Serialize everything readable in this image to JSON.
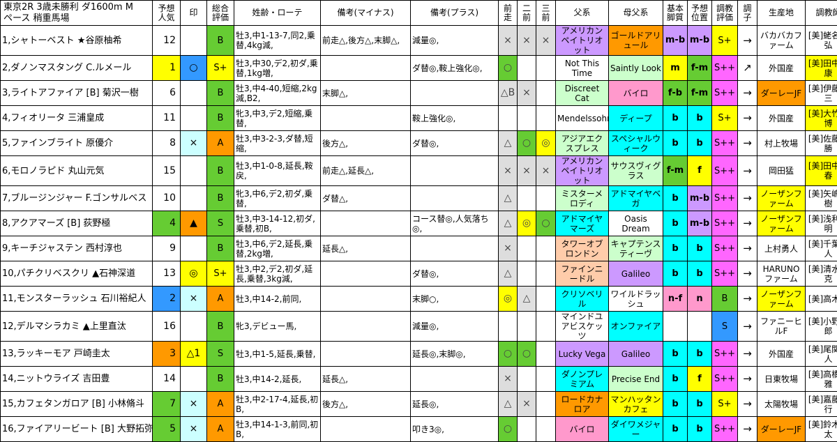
{
  "header": {
    "title_line1": "東京2R 3歳未勝利 ダ1600m M",
    "title_line2": "ペース 稍重馬場",
    "cols": {
      "pop": "予想\n人気",
      "mark": "印",
      "total": "総合\n評価",
      "info": "姓齢・ローテ",
      "minus": "備考(マイナス)",
      "plus": "備考(プラス)",
      "prev1": "前\n走",
      "prev2": "二\n前",
      "prev3": "三\n前",
      "sire": "父系",
      "damsire": "母父系",
      "basic": "基本\n脚質",
      "pos": "予想\n位置",
      "train": "調教\n評価",
      "cond": "調\n子",
      "origin": "生産地",
      "trainer": "調教師"
    }
  },
  "colors": {
    "yellow": "#ffff00",
    "green": "#66cc33",
    "ltgreen": "#ccffcc",
    "pink": "#ff99cc",
    "orange": "#ff9900",
    "cyan": "#00ffff",
    "purple": "#cc99ff",
    "magenta": "#ff66ff",
    "ltcyan": "#ccffff",
    "peach": "#ffccaa",
    "blue": "#3399ff",
    "ltblue": "#99ccff"
  },
  "rows": [
    {
      "name": "1,シャトーベスト ★谷原柚希",
      "pop": "12",
      "mark": "",
      "total": "B",
      "info": "牡3,中1-13-7,同2,乗替,4kg減,",
      "minus": "前走△,後方△,末脚△,",
      "plus": "減量◎,",
      "p1": "×",
      "p2": "×",
      "p3": "×",
      "sire": "アメリカンペイトリオット",
      "dam": "ゴールドアリュール",
      "basic": "m-b",
      "pos": "m-b",
      "train": "S+",
      "cond": "→",
      "origin": "バカバカファーム",
      "trainer": "[美]蛯名利弘"
    },
    {
      "name": "2,ダノンマスタング C.ルメール",
      "pop": "1",
      "mark": "○",
      "total": "S+",
      "info": "牡3,中30,デ2,初ダ,乗替,1kg増,",
      "minus": "",
      "plus": "ダ替◎,鞍上強化◎,",
      "p1": "○",
      "p2": "",
      "p3": "",
      "sire": "Not This Time",
      "dam": "Saintly Look",
      "basic": "m",
      "pos": "f-m",
      "train": "S++",
      "cond": "↗",
      "origin": "外国産",
      "trainer": "[美]田中博康"
    },
    {
      "name": "3,ライトアファイア [B] 菊沢一樹",
      "pop": "6",
      "mark": "",
      "total": "B",
      "info": "牡3,中4-40,短縮,2kg減,B2,",
      "minus": "末脚△,",
      "plus": "",
      "p1": "△B",
      "p2": "×",
      "p3": "",
      "sire": "Discreet Cat",
      "dam": "バイロ",
      "basic": "f-b",
      "pos": "f-m",
      "train": "S++",
      "cond": "→",
      "origin": "ダーレーJF",
      "trainer": "[美]伊藤圭三"
    },
    {
      "name": "4,フィオリータ 三浦皇成",
      "pop": "11",
      "mark": "",
      "total": "B",
      "info": "牝3,中3,デ2,短縮,乗替,",
      "minus": "",
      "plus": "鞍上強化◎,",
      "p1": "",
      "p2": "",
      "p3": "",
      "sire": "Mendelssohn",
      "dam": "ディープ",
      "basic": "b",
      "pos": "b",
      "train": "S+",
      "cond": "→",
      "origin": "外国産",
      "trainer": "[美]大竹正博"
    },
    {
      "name": "5,ファインブライト 原優介",
      "pop": "8",
      "mark": "×",
      "total": "A",
      "info": "牡3,中3-2-3,ダ替,短縮,",
      "minus": "後方△,",
      "plus": "ダ替◎,",
      "p1": "△",
      "p2": "○",
      "p3": "◎",
      "sire": "アジアエクスプレス",
      "dam": "スペシャルウィーク",
      "basic": "b",
      "pos": "b",
      "train": "S++",
      "cond": "→",
      "origin": "村上牧場",
      "trainer": "[美]佐藤吉勝"
    },
    {
      "name": "6,モロノラピド 丸山元気",
      "pop": "15",
      "mark": "",
      "total": "B",
      "info": "牡3,中1-0-8,延長,鞍戻,",
      "minus": "前走△,延長△,",
      "plus": "",
      "p1": "×",
      "p2": "×",
      "p3": "×",
      "sire": "アメリカンペイトリオット",
      "dam": "サウスヴィグラス",
      "basic": "f-m",
      "pos": "f",
      "train": "S++",
      "cond": "→",
      "origin": "岡田猛",
      "trainer": "[美]田中勝春"
    },
    {
      "name": "7,ブルージンジャー F.ゴンサルベス",
      "pop": "10",
      "mark": "",
      "total": "B",
      "info": "牝3,中6,デ2,初ダ,乗替,",
      "minus": "ダ替△,",
      "plus": "",
      "p1": "△",
      "p2": "",
      "p3": "",
      "sire": "ミスターメロディ",
      "dam": "アドマイヤベガ",
      "basic": "b",
      "pos": "m-b",
      "train": "S++",
      "cond": "→",
      "origin": "ノーザンファーム",
      "trainer": "[美]矢嶋大樹"
    },
    {
      "name": "8,アクアマーズ [B] 荻野極",
      "pop": "4",
      "mark": "▲",
      "total": "S",
      "info": "牡3,中3-14-12,初ダ,乗替,初B,",
      "minus": "",
      "plus": "コース替◎,人気落ち◎,",
      "p1": "△",
      "p2": "◎",
      "p3": "○",
      "sire": "アドマイヤマーズ",
      "dam": "Oasis Dream",
      "basic": "b",
      "pos": "m-b",
      "train": "S++",
      "cond": "→",
      "origin": "ノーザンファーム",
      "trainer": "[美]浅利英明"
    },
    {
      "name": "9,キーチジャステン 西村淳也",
      "pop": "9",
      "mark": "",
      "total": "B",
      "info": "牡3,中6,デ2,延長,乗替,2kg増,",
      "minus": "延長△,",
      "plus": "",
      "p1": "×",
      "p2": "",
      "p3": "",
      "sire": "タワーオブロンドン",
      "dam": "キャプテンスティーヴ",
      "basic": "b",
      "pos": "b",
      "train": "S++",
      "cond": "→",
      "origin": "上村勇人",
      "trainer": "[美]千葉直人"
    },
    {
      "name": "10,パチクリベスクリ ▲石神深道",
      "pop": "13",
      "mark": "◎",
      "total": "S+",
      "info": "牡3,中2,デ2,初ダ,延長,乗替,3kg減,",
      "minus": "",
      "plus": "ダ替◎,",
      "p1": "△",
      "p2": "",
      "p3": "",
      "sire": "ファインニードル",
      "dam": "Galileo",
      "basic": "b",
      "pos": "b",
      "train": "S++",
      "cond": "→",
      "origin": "HARUNOファーム",
      "trainer": "[美]清水英克"
    },
    {
      "name": "11,モンスターラッシュ 石川裕紀人",
      "pop": "2",
      "mark": "×",
      "total": "A",
      "info": "牡3,中14-2,前同,",
      "minus": "",
      "plus": "末脚○,",
      "p1": "◎",
      "p2": "△",
      "p3": "",
      "sire": "クリソベリル",
      "dam": "ワイルドラッシュ",
      "basic": "n-f",
      "pos": "n",
      "train": "B",
      "cond": "→",
      "origin": "ノーザンファーム",
      "trainer": "[美]高木登"
    },
    {
      "name": "12,デルマシラカミ ▲上里直汰",
      "pop": "16",
      "mark": "",
      "total": "B",
      "info": "牝3,デビュー馬,",
      "minus": "",
      "plus": "減量◎,",
      "p1": "",
      "p2": "",
      "p3": "",
      "sire": "マインドユアビスケッツ",
      "dam": "オンファイア",
      "basic": "",
      "pos": "",
      "train": "S",
      "cond": "→",
      "origin": "ファニーヒルF",
      "trainer": "[美]小野次郎"
    },
    {
      "name": "13,ラッキーモア 戸崎圭太",
      "pop": "3",
      "mark": "△1",
      "total": "S",
      "info": "牡3,中1-5,延長,乗替,",
      "minus": "",
      "plus": "延長◎,末脚◎,",
      "p1": "○",
      "p2": "○",
      "p3": "",
      "sire": "Lucky Vega",
      "dam": "Galileo",
      "basic": "b",
      "pos": "b",
      "train": "S++",
      "cond": "→",
      "origin": "外国産",
      "trainer": "[美]尾関知人"
    },
    {
      "name": "14,ニットウライズ 吉田豊",
      "pop": "14",
      "mark": "",
      "total": "B",
      "info": "牡3,中14-2,延長,",
      "minus": "延長△,",
      "plus": "",
      "p1": "×",
      "p2": "",
      "p3": "",
      "sire": "ダノンプレミアム",
      "dam": "Precise End",
      "basic": "b",
      "pos": "f",
      "train": "S++",
      "cond": "→",
      "origin": "日東牧場",
      "trainer": "[美]高橋文雅"
    },
    {
      "name": "15,カフェタンガロア [B] 小林脩斗",
      "pop": "7",
      "mark": "×",
      "total": "A",
      "info": "牡3,中2-17-4,延長,初B,",
      "minus": "後方△,",
      "plus": "延長◎,",
      "p1": "△",
      "p2": "×",
      "p3": "",
      "sire": "ロードカナロア",
      "dam": "マンハッタンカフェ",
      "basic": "b",
      "pos": "b",
      "train": "S+",
      "cond": "→",
      "origin": "太陽牧場",
      "trainer": "[美]嘉藤貴行"
    },
    {
      "name": "16,ファイアリービート [B] 大野拓弥",
      "pop": "5",
      "mark": "×",
      "total": "A",
      "info": "牡3,中14-1-3,前同,初B,",
      "minus": "",
      "plus": "叩き3◎,",
      "p1": "○",
      "p2": "",
      "p3": "",
      "sire": "バイロ",
      "dam": "ダイワメジャー",
      "basic": "b",
      "pos": "b",
      "train": "S++",
      "cond": "→",
      "origin": "ダーレーJF",
      "trainer": "[美]鈴木慎太"
    }
  ]
}
